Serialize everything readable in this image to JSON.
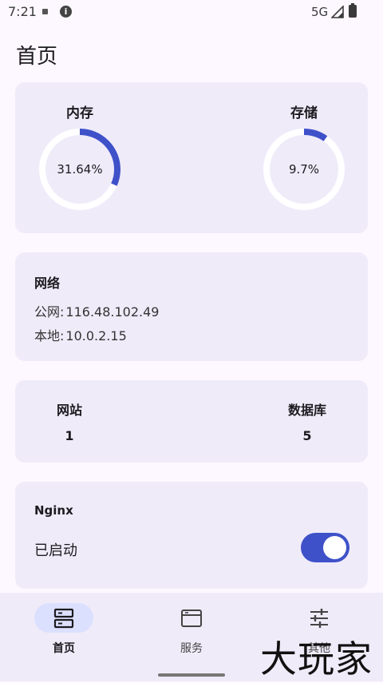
{
  "status_bar": {
    "time": "7:21",
    "network": "5G"
  },
  "page": {
    "title": "首页"
  },
  "gauges": [
    {
      "label": "内存",
      "value_text": "31.64%",
      "percent": 31.64
    },
    {
      "label": "存储",
      "value_text": "9.7%",
      "percent": 9.7
    }
  ],
  "network": {
    "title": "网络",
    "public_label": "公网:",
    "public_ip": "116.48.102.49",
    "local_label": "本地:",
    "local_ip": "10.0.2.15"
  },
  "counts": [
    {
      "label": "网站",
      "value": "1"
    },
    {
      "label": "数据库",
      "value": "5"
    }
  ],
  "nginx": {
    "title": "Nginx",
    "status": "已启动",
    "enabled": true
  },
  "bottom_nav": [
    {
      "label": "首页",
      "icon": "server-icon",
      "active": true
    },
    {
      "label": "服务",
      "icon": "window-icon",
      "active": false
    },
    {
      "label": "其他",
      "icon": "sliders-icon",
      "active": false
    }
  ],
  "watermark": "大玩家",
  "colors": {
    "accent": "#3f51c9",
    "card": "#efebf9",
    "background": "#fdf8ff",
    "track": "#ffffff"
  }
}
